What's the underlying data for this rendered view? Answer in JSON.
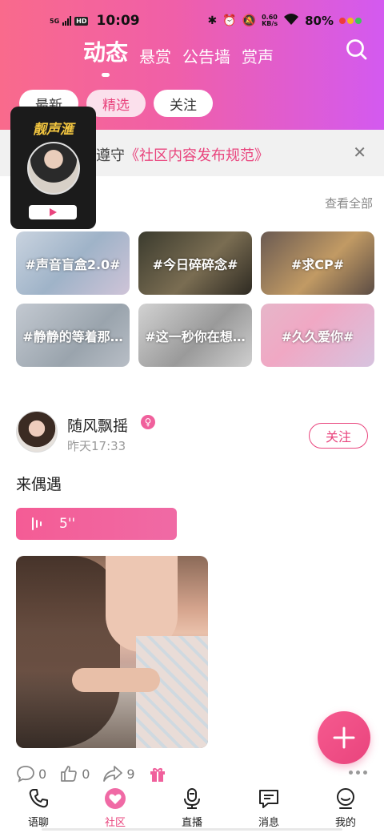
{
  "status_bar": {
    "network": "5G",
    "hd": "HD",
    "time": "10:09",
    "speed_value": "0.60",
    "speed_unit": "KB/s",
    "battery": "80%"
  },
  "header": {
    "tabs": [
      {
        "label": "动态",
        "active": true
      },
      {
        "label": "悬赏",
        "active": false
      },
      {
        "label": "公告墙",
        "active": false
      },
      {
        "label": "赏声",
        "active": false
      }
    ],
    "search_icon": "search-icon"
  },
  "sub_tabs": [
    {
      "label": "最新",
      "active": false
    },
    {
      "label": "精选",
      "active": true
    },
    {
      "label": "关注",
      "active": false
    }
  ],
  "notice": {
    "prefix": "遵守",
    "link": "《社区内容发布规范》",
    "close_icon": "close-icon"
  },
  "floating_card": {
    "title": "靓声滙"
  },
  "topics_section": {
    "view_all": "查看全部",
    "topics": [
      {
        "label": "#声音盲盒2.0#"
      },
      {
        "label": "#今日碎碎念#"
      },
      {
        "label": "#求CP#"
      },
      {
        "label": "#静静的等着那…"
      },
      {
        "label": "#这一秒你在想…"
      },
      {
        "label": "#久久爱你#"
      }
    ]
  },
  "post": {
    "user_name": "随风飘摇",
    "gender_icon": "♀",
    "time": "昨天17:33",
    "follow_label": "关注",
    "text": "来偶遇",
    "voice_duration": "5''",
    "comments": "0",
    "likes": "0",
    "shares": "9"
  },
  "bottom_nav": [
    {
      "label": "语聊",
      "icon": "phone-icon",
      "active": false
    },
    {
      "label": "社区",
      "icon": "heart-icon",
      "active": true
    },
    {
      "label": "直播",
      "icon": "microphone-icon",
      "active": false
    },
    {
      "label": "消息",
      "icon": "message-icon",
      "active": false
    },
    {
      "label": "我的",
      "icon": "profile-icon",
      "active": false
    }
  ],
  "colors": {
    "accent": "#e9447d",
    "header_gradient_start": "#f96a8c",
    "header_gradient_end": "#d35af0"
  }
}
